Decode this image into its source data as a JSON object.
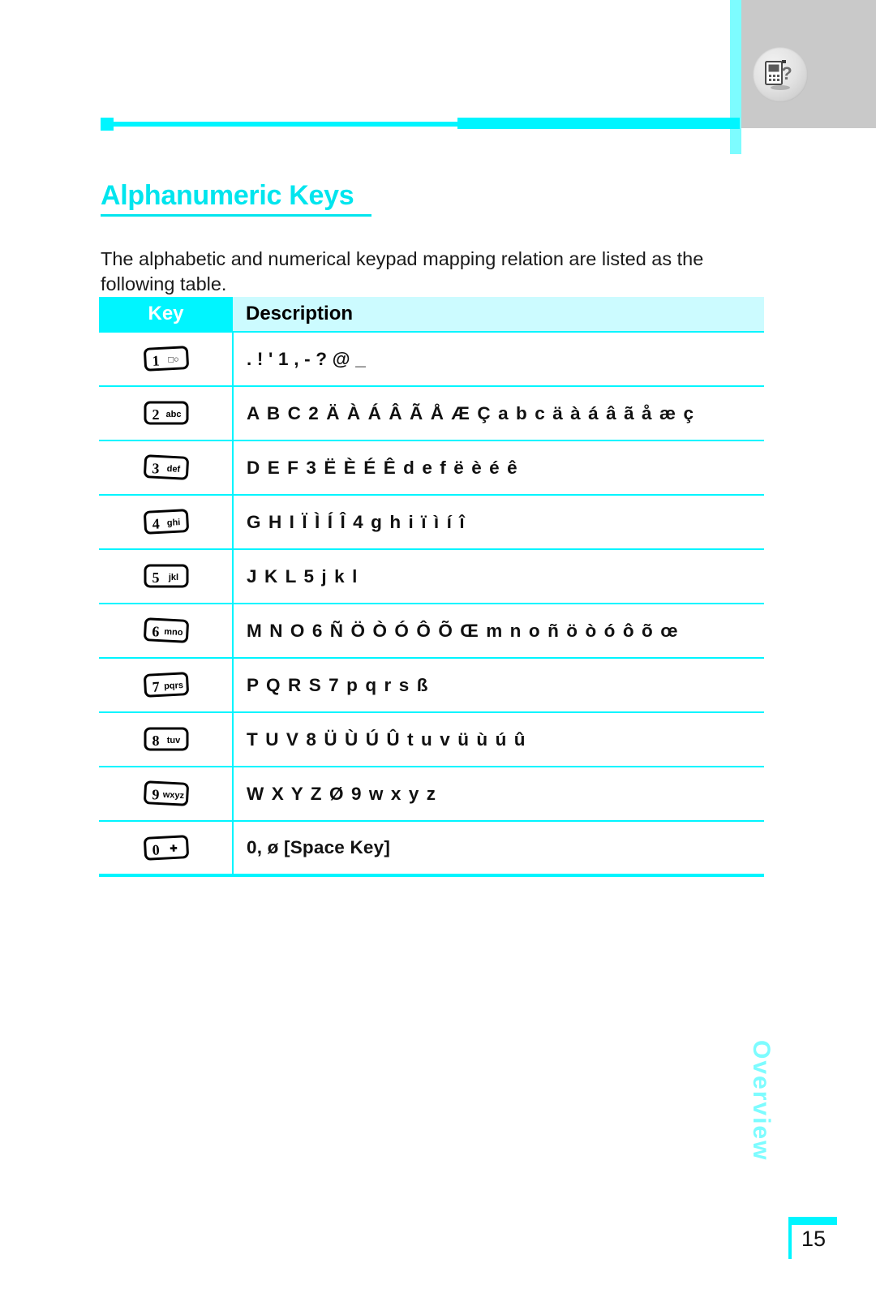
{
  "header": {
    "help_icon": "device-help-icon",
    "decor_rule": "cyan-rule"
  },
  "page": {
    "title": "Alphanumeric Keys",
    "intro": "The alphabetic and numerical keypad mapping relation are listed as the following table.",
    "side_tab_label": "Overview",
    "page_number": "15"
  },
  "table": {
    "headers": {
      "key": "Key",
      "description": "Description"
    },
    "rows": [
      {
        "key_digit": "1",
        "key_sub": "□○",
        "key_name": "key-1",
        "description": ". ! ' 1 , - ? @ _"
      },
      {
        "key_digit": "2",
        "key_sub": "abc",
        "key_name": "key-2",
        "description": "A B C 2 Ä À Á Â Ã Å Æ Ç a b c ä à á â ã å æ ç"
      },
      {
        "key_digit": "3",
        "key_sub": "def",
        "key_name": "key-3",
        "description": "D E F 3 Ë È É Ê d e f ë è é ê"
      },
      {
        "key_digit": "4",
        "key_sub": "ghi",
        "key_name": "key-4",
        "description": "G H I Ï Ì Í Î 4 g h i ï ì í î"
      },
      {
        "key_digit": "5",
        "key_sub": "jkl",
        "key_name": "key-5",
        "description": "J K L 5 j k l"
      },
      {
        "key_digit": "6",
        "key_sub": "mno",
        "key_name": "key-6",
        "description": "M N O 6 Ñ Ö Ò Ó Ô Õ Œ m n o ñ ö ò ó ô õ œ"
      },
      {
        "key_digit": "7",
        "key_sub": "pqrs",
        "key_name": "key-7",
        "description": "P Q R S 7 p q r s ß"
      },
      {
        "key_digit": "8",
        "key_sub": "tuv",
        "key_name": "key-8",
        "description": "T U V 8 Ü Ù Ú Û t u v ü ù ú û"
      },
      {
        "key_digit": "9",
        "key_sub": "wxyz",
        "key_name": "key-9",
        "description": "W X Y Z Ø 9 w x y z"
      },
      {
        "key_digit": "0",
        "key_sub": "✚",
        "key_name": "key-0",
        "description": "0, ø [Space Key]"
      }
    ]
  },
  "colors": {
    "accent_cyan": "#00F5FF",
    "accent_cyan_soft": "#7DFCFF",
    "header_desc_bg": "#CCFBFF",
    "title_cyan": "#00E5EE",
    "gray_block": "#C9C9C9",
    "text_black": "#111111"
  }
}
